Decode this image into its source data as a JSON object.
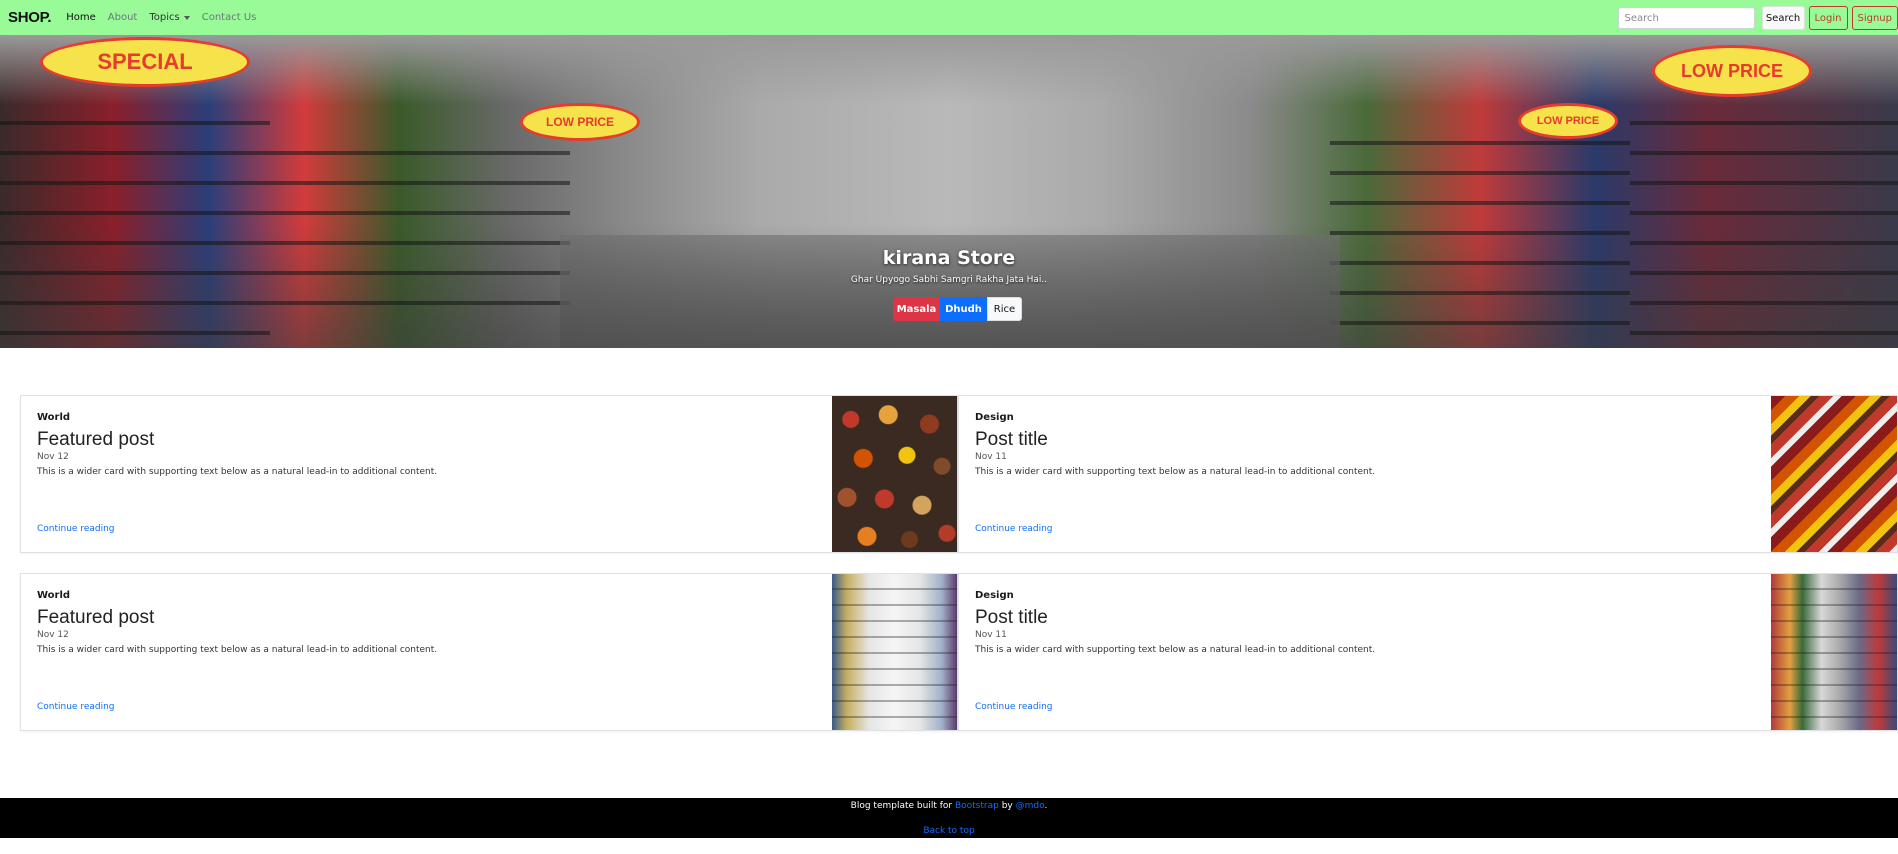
{
  "navbar": {
    "brand": "SHOP.",
    "links": [
      "Home",
      "About",
      "Topics",
      "Contact Us"
    ],
    "search_placeholder": "Search",
    "search_button": "Search",
    "login": "Login",
    "signup": "Signup"
  },
  "hero": {
    "title": "kirana Store",
    "subtitle": "Ghar Upyogo Sabhi Samgri Rakha Jata Hai..",
    "buttons": [
      "Masala",
      "Dhudh",
      "Rice"
    ],
    "signs": [
      "SPECIAL",
      "LOW PRICE",
      "LOW PRICE",
      "LOW PRICE"
    ]
  },
  "cards": [
    {
      "category": "World",
      "title": "Featured post",
      "date": "Nov 12",
      "text": "This is a wider card with supporting text below as a natural lead-in to additional content.",
      "link": "Continue reading"
    },
    {
      "category": "Design",
      "title": "Post title",
      "date": "Nov 11",
      "text": "This is a wider card with supporting text below as a natural lead-in to additional content.",
      "link": "Continue reading"
    },
    {
      "category": "World",
      "title": "Featured post",
      "date": "Nov 12",
      "text": "This is a wider card with supporting text below as a natural lead-in to additional content.",
      "link": "Continue reading"
    },
    {
      "category": "Design",
      "title": "Post title",
      "date": "Nov 11",
      "text": "This is a wider card with supporting text below as a natural lead-in to additional content.",
      "link": "Continue reading"
    }
  ],
  "footer": {
    "text_before": "Blog template built for ",
    "bootstrap": "Bootstrap",
    "text_by": " by ",
    "mdo": "@mdo",
    "text_end": ".",
    "back_to_top": "Back to top"
  }
}
